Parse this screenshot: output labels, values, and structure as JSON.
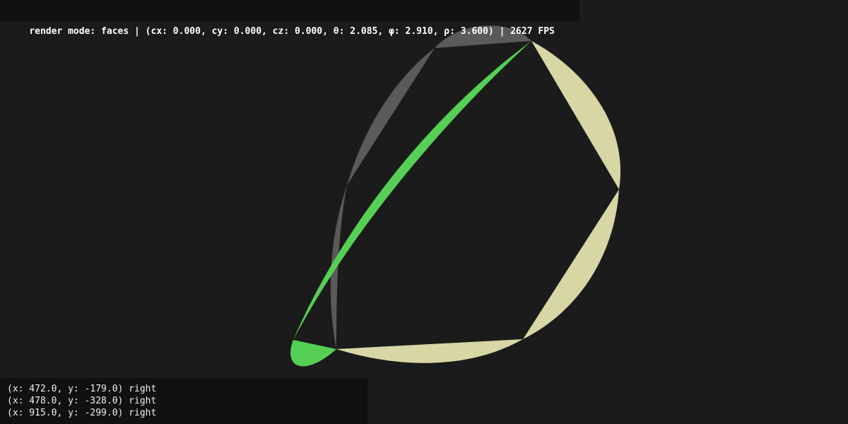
{
  "status": {
    "text": "render mode: faces | (cx: 0.000, cy: 0.000, cz: 0.000, θ: 2.085, φ: 2.910, ρ: 3.600) | 2627 FPS"
  },
  "scene": {
    "colors": {
      "background": "#1b1b1b",
      "gray_face": "#5a5a5a",
      "yellow_face": "#d6d7a4",
      "green_face": "#55d055"
    }
  },
  "log": {
    "lines": [
      "(x: 472.0, y: -179.0) right",
      "(x: 478.0, y: -328.0) right",
      "(x: 915.0, y: -299.0) right"
    ]
  }
}
